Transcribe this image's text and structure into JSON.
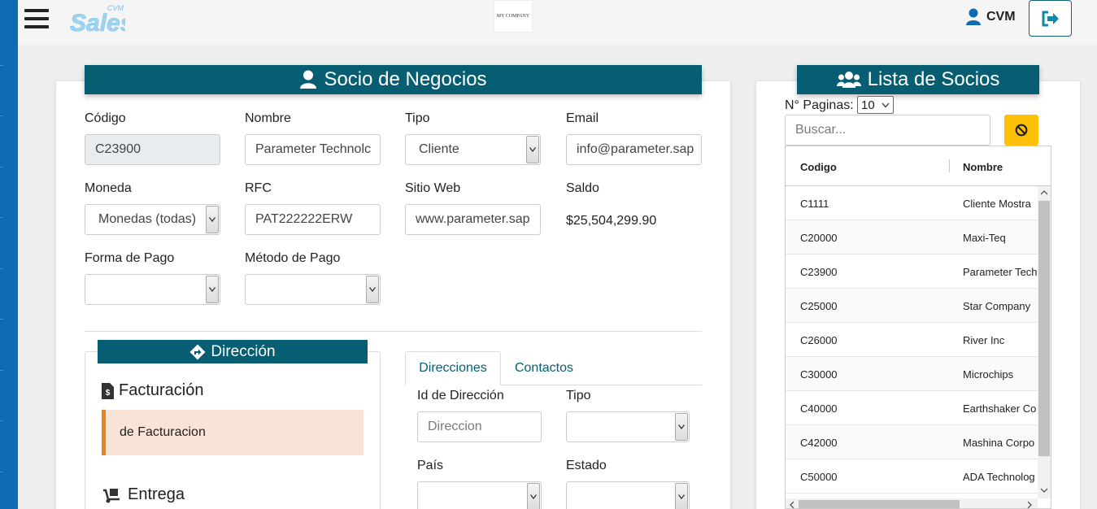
{
  "colors": {
    "primary": "#075e72",
    "sidebar": "#0e6bb3",
    "warning": "#ffc107",
    "accent_orange": "#f07f1e",
    "highlight_bg": "#f9e2d6"
  },
  "header": {
    "logo_text": "Sales",
    "logo_small": "CVM",
    "company_logo_text": "MY COMPANY",
    "user_name": "CVM",
    "icons": [
      "menu-icon",
      "user-icon",
      "sign-out-icon"
    ]
  },
  "socio": {
    "title": "Socio de Negocios",
    "codigo_label": "Código",
    "codigo_value": "C23900",
    "nombre_label": "Nombre",
    "nombre_value": "Parameter Technolc",
    "tipo_label": "Tipo",
    "tipo_value": "Cliente",
    "email_label": "Email",
    "email_value": "info@parameter.sap",
    "moneda_label": "Moneda",
    "moneda_value": "Monedas (todas)",
    "rfc_label": "RFC",
    "rfc_value": "PAT222222ERW",
    "sitio_label": "Sitio Web",
    "sitio_value": "www.parameter.sap",
    "saldo_label": "Saldo",
    "saldo_value": "$25,504,299.90",
    "forma_label": "Forma de Pago",
    "forma_value": "",
    "metodo_label": "Método de Pago",
    "metodo_value": ""
  },
  "direccion": {
    "title": "Dirección",
    "facturacion_label": "Facturación",
    "facturacion_value": "de Facturacion",
    "entrega_label": "Entrega",
    "tabs": [
      "Direcciones",
      "Contactos"
    ],
    "id_label": "Id de Dirección",
    "id_placeholder": "Direccion",
    "tipo_label": "Tipo",
    "pais_label": "País",
    "estado_label": "Estado"
  },
  "lista": {
    "title": "Lista de Socios",
    "pages_label": "N° Paginas:",
    "pages_value": "10",
    "search_placeholder": "Buscar...",
    "columns": [
      "Codigo",
      "Nombre"
    ],
    "rows": [
      [
        "C1111",
        "Cliente Mostra"
      ],
      [
        "C20000",
        "Maxi-Teq"
      ],
      [
        "C23900",
        "Parameter Tech"
      ],
      [
        "C25000",
        "Star Company"
      ],
      [
        "C26000",
        "River Inc"
      ],
      [
        "C30000",
        "Microchips"
      ],
      [
        "C40000",
        "Earthshaker Co"
      ],
      [
        "C42000",
        "Mashina Corpo"
      ],
      [
        "C50000",
        "ADA Technolog"
      ]
    ]
  }
}
